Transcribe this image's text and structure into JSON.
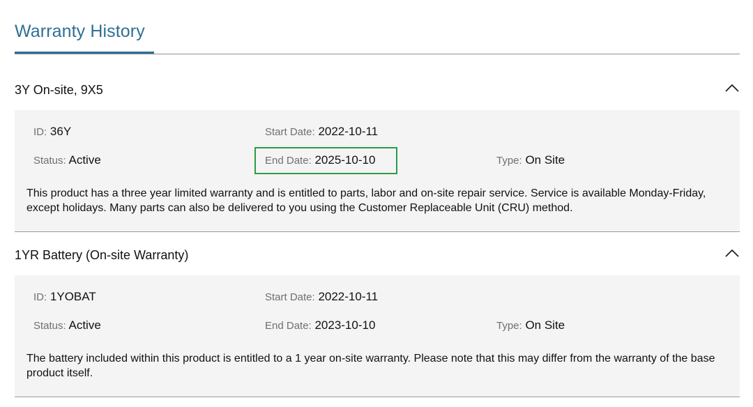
{
  "page": {
    "title": "Warranty History"
  },
  "warranties": [
    {
      "name": "3Y On-site, 9X5",
      "id_label": "ID",
      "id_value": "36Y",
      "start_label": "Start Date",
      "start_value": "2022-10-11",
      "status_label": "Status",
      "status_value": "Active",
      "end_label": "End Date",
      "end_value": "2025-10-10",
      "type_label": "Type",
      "type_value": "On Site",
      "description": "This product has a three year limited warranty and is entitled to parts, labor and on-site repair service. Service is available Monday-Friday, except holidays. Many parts can also be delivered to you using the Customer Replaceable Unit (CRU) method.",
      "highlight_color": "#2c9c45"
    },
    {
      "name": "1YR Battery (On-site Warranty)",
      "id_label": "ID",
      "id_value": "1YOBAT",
      "start_label": "Start Date",
      "start_value": "2022-10-11",
      "status_label": "Status",
      "status_value": "Active",
      "end_label": "End Date",
      "end_value": "2023-10-10",
      "type_label": "Type",
      "type_value": "On Site",
      "description": "The battery included within this product is entitled to a 1 year on-site warranty. Please note that this may differ from the warranty of the base product itself."
    }
  ],
  "icons": {
    "collapse": "chevron-up-icon"
  },
  "colors": {
    "accent": "#2f6f95",
    "panel_bg": "#f4f4f4",
    "label": "#6f6f6f"
  }
}
